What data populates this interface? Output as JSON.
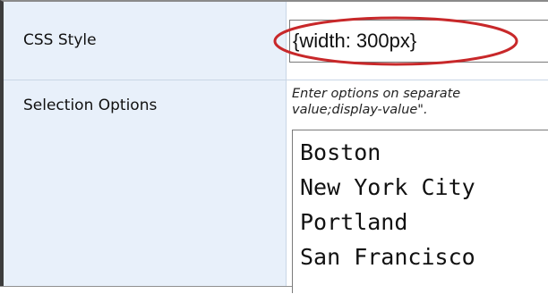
{
  "form": {
    "rows": [
      {
        "label": "CSS Style",
        "value": "{width: 300px}"
      },
      {
        "label": "Selection Options",
        "hint_line1": "Enter options on separate",
        "hint_line2": "value;display-value\".",
        "options": [
          "Boston",
          "New York City",
          "Portland",
          "San Francisco"
        ]
      }
    ]
  },
  "colors": {
    "label_background": "#e8f0fa",
    "highlight_oval": "#c8282a"
  }
}
